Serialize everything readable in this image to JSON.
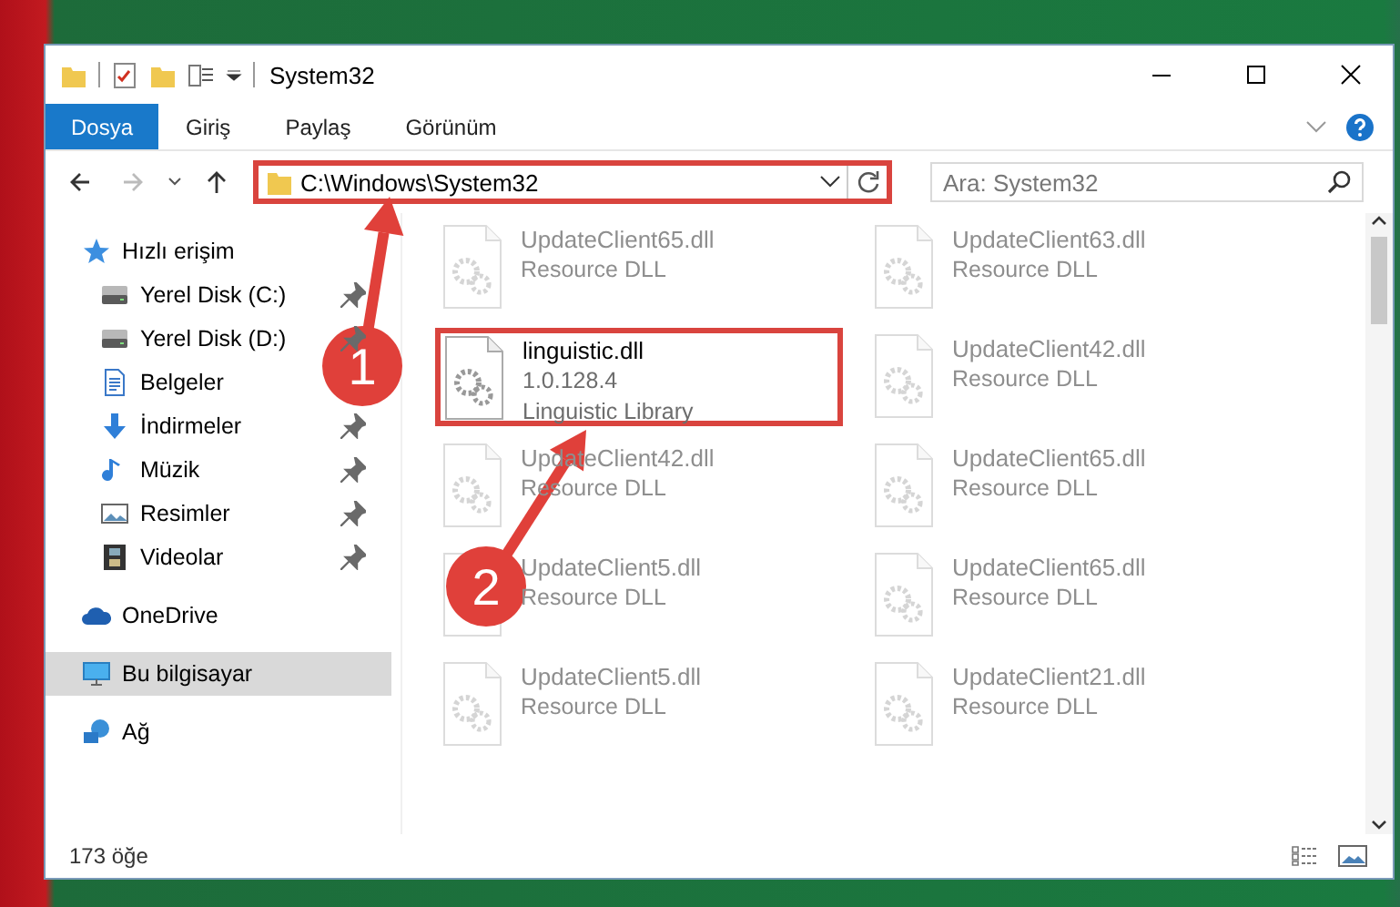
{
  "window": {
    "title": "System32"
  },
  "ribbon": {
    "tabs": [
      {
        "label": "Dosya",
        "selected": true
      },
      {
        "label": "Giriş",
        "selected": false
      },
      {
        "label": "Paylaş",
        "selected": false
      },
      {
        "label": "Görünüm",
        "selected": false
      }
    ]
  },
  "address": {
    "path": "C:\\Windows\\System32",
    "outlined": true
  },
  "search": {
    "placeholder": "Ara: System32"
  },
  "navigation": {
    "items": [
      {
        "label": "Hızlı erişim",
        "kind": "star",
        "selected": false,
        "children": [
          {
            "label": "Yerel Disk (C:)",
            "kind": "drive",
            "selected": false,
            "pinned": true
          },
          {
            "label": "Yerel Disk (D:)",
            "kind": "drive",
            "selected": false,
            "pinned": true
          },
          {
            "label": "Belgeler",
            "kind": "document",
            "selected": false,
            "pinned": false
          },
          {
            "label": "İndirmeler",
            "kind": "download",
            "selected": false,
            "pinned": true
          },
          {
            "label": "Müzik",
            "kind": "music",
            "selected": false,
            "pinned": true
          },
          {
            "label": "Resimler",
            "kind": "picture",
            "selected": false,
            "pinned": true
          },
          {
            "label": "Videolar",
            "kind": "video",
            "selected": false,
            "pinned": true
          }
        ]
      },
      {
        "label": "OneDrive",
        "kind": "cloud",
        "selected": false
      },
      {
        "label": "Bu bilgisayar",
        "kind": "computer",
        "selected": true
      },
      {
        "label": "Ağ",
        "kind": "network",
        "selected": false
      }
    ]
  },
  "files": [
    {
      "name": "UpdateClient65.dll",
      "details": [
        "Resource DLL"
      ],
      "faded": true,
      "outlined": false
    },
    {
      "name": "UpdateClient63.dll",
      "details": [
        "Resource DLL"
      ],
      "faded": true,
      "outlined": false
    },
    {
      "name": "linguistic.dll",
      "details": [
        "1.0.128.4",
        "Linguistic Library"
      ],
      "faded": false,
      "outlined": true
    },
    {
      "name": "UpdateClient42.dll",
      "details": [
        "Resource DLL"
      ],
      "faded": true,
      "outlined": false
    },
    {
      "name": "UpdateClient42.dll",
      "details": [
        "Resource DLL"
      ],
      "faded": true,
      "outlined": false
    },
    {
      "name": "UpdateClient65.dll",
      "details": [
        "Resource DLL"
      ],
      "faded": true,
      "outlined": false
    },
    {
      "name": "UpdateClient5.dll",
      "details": [
        "Resource DLL"
      ],
      "faded": true,
      "outlined": false
    },
    {
      "name": "UpdateClient65.dll",
      "details": [
        "Resource DLL"
      ],
      "faded": true,
      "outlined": false
    },
    {
      "name": "UpdateClient5.dll",
      "details": [
        "Resource DLL"
      ],
      "faded": true,
      "outlined": false
    },
    {
      "name": "UpdateClient21.dll",
      "details": [
        "Resource DLL"
      ],
      "faded": true,
      "outlined": false
    }
  ],
  "callouts": [
    {
      "number": "1"
    },
    {
      "number": "2"
    }
  ],
  "status_bar": {
    "count": "173 öğe"
  }
}
